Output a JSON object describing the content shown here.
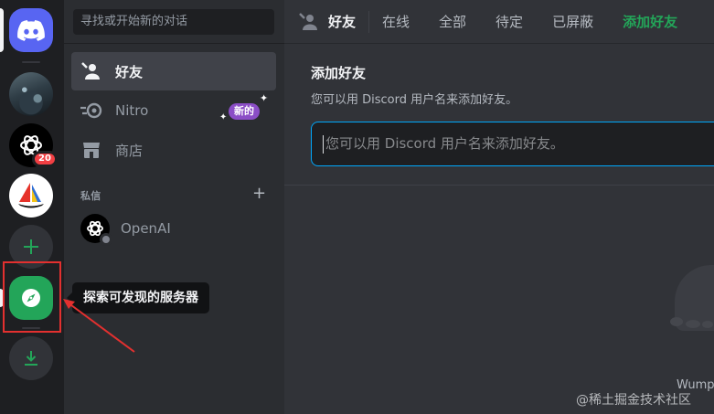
{
  "rail": {
    "badge_count": "20",
    "tooltip": "探索可发现的服务器"
  },
  "dm_sidebar": {
    "search_placeholder": "寻找或开始新的对话",
    "nav": [
      {
        "label": "好友",
        "icon": "friends-icon"
      },
      {
        "label": "Nitro",
        "icon": "nitro-icon"
      },
      {
        "label": "商店",
        "icon": "shop-icon"
      }
    ],
    "new_badge": "新的",
    "dm_header": "私信",
    "dm_add": "+",
    "dms": [
      {
        "name": "OpenAI"
      }
    ]
  },
  "topbar": {
    "title": "好友",
    "tabs": [
      "在线",
      "全部",
      "待定",
      "已屏蔽"
    ],
    "add_friend": "添加好友"
  },
  "add_friend_panel": {
    "title": "添加好友",
    "subtitle": "您可以用 Discord 用户名来添加好友。",
    "placeholder": "您可以用 Discord 用户名来添加好友。"
  },
  "empty_state": {
    "text": "Wump"
  },
  "watermark": "@稀土掘金技术社区",
  "colors": {
    "blurple": "#5865f2",
    "green": "#23a559",
    "red_badge": "#f23f43",
    "nitro_purple": "#8b4ec6",
    "annotation_red": "#e3302f"
  }
}
